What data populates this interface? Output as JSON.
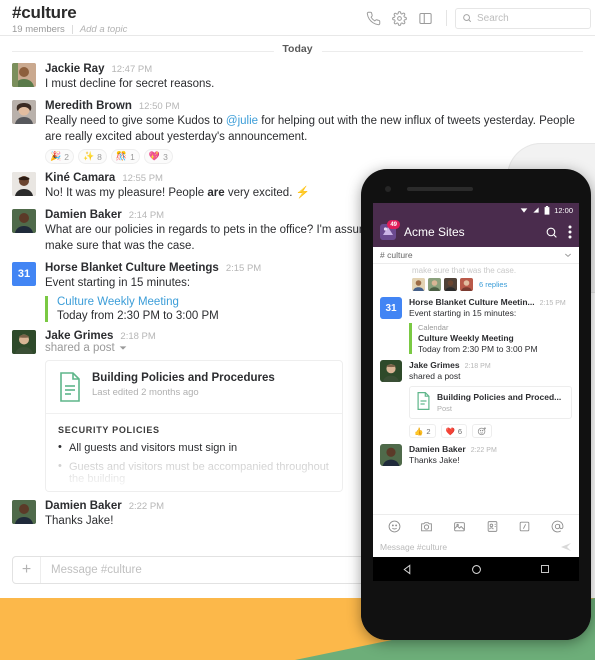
{
  "desktop": {
    "channel": {
      "name": "#culture",
      "members": "19 members",
      "topic": "Add a topic"
    },
    "header_icons": [
      "phone-icon",
      "gear-icon",
      "sidebar-icon"
    ],
    "search": {
      "placeholder": "Search",
      "icon": "search-icon"
    },
    "day_divider": "Today",
    "messages": [
      {
        "author": "Jackie Ray",
        "time": "12:47 PM",
        "text": "I must decline for secret reasons."
      },
      {
        "author": "Meredith Brown",
        "time": "12:50 PM",
        "text_pre": "Really need to give some Kudos to ",
        "mention": "@julie",
        "text_post": " for helping out with the new influx of tweets yesterday. People are really excited about yesterday's announcement.",
        "reactions": [
          {
            "emoji": "🎉",
            "count": "2"
          },
          {
            "emoji": "✨",
            "count": "8"
          },
          {
            "emoji": "🎊",
            "count": "1"
          },
          {
            "emoji": "💖",
            "count": "3"
          }
        ]
      },
      {
        "author": "Kiné Camara",
        "time": "12:55 PM",
        "text_pre": "No! It was my pleasure! People ",
        "bold": "are",
        "text_post": " very excited. ⚡"
      },
      {
        "author": "Damien Baker",
        "time": "2:14 PM",
        "text": "What are our policies in regards to pets in the office? I'm assuming we can bring them in but I want to make sure that was the case."
      },
      {
        "author": "Horse Blanket Culture Meetings",
        "time": "2:15 PM",
        "avatar": "calendar-icon",
        "avatar_label": "31",
        "text": "Event starting in 15 minutes:",
        "attachment": {
          "title": "Culture Weekly Meeting",
          "when": "Today from 2:30 PM to 3:00 PM"
        }
      },
      {
        "author": "Jake Grimes",
        "time": "2:18 PM",
        "shared": "shared a post",
        "post": {
          "title": "Building Policies and Procedures",
          "subtitle": "Last edited 2 months ago",
          "section": "SECURITY POLICIES",
          "bullets": [
            "All guests and visitors must sign in",
            "Guests and visitors must be accompanied throughout the building"
          ]
        }
      },
      {
        "author": "Damien Baker",
        "time": "2:22 PM",
        "text": "Thanks Jake!"
      }
    ],
    "composer": {
      "plus": "+",
      "placeholder": "Message #culture"
    }
  },
  "phone": {
    "statusbar": {
      "time": "12:00",
      "icons": [
        "wifi-icon",
        "signal-icon",
        "battery-icon"
      ]
    },
    "appbar": {
      "title": "Acme Sites",
      "badge": "49",
      "search_icon": "search-icon",
      "overflow_icon": "more-vertical-icon"
    },
    "channel_bar": {
      "name": "# culture",
      "chevron": "chevron-down-icon"
    },
    "cut_text": "make sure that was the case.",
    "thread": {
      "replies": "6 replies"
    },
    "messages": [
      {
        "author": "Horse Blanket Culture Meetin...",
        "time": "2:15 PM",
        "avatar": "calendar-icon",
        "avatar_label": "31",
        "text": "Event starting in 15 minutes:",
        "attachment": {
          "kicker": "Calendar",
          "title": "Culture Weekly Meeting",
          "when": "Today from 2:30 PM to 3:00 PM"
        }
      },
      {
        "author": "Jake Grimes",
        "time": "2:18 PM",
        "shared": "shared a post",
        "post": {
          "title": "Building Policies and Proced...",
          "subtitle": "Post"
        },
        "reactions": [
          {
            "emoji": "👍",
            "count": "2"
          },
          {
            "emoji": "❤️",
            "count": "6"
          },
          {
            "emoji": "add-reaction-icon",
            "count": ""
          }
        ]
      },
      {
        "author": "Damien Baker",
        "time": "2:22 PM",
        "text": "Thanks Jake!"
      }
    ],
    "toolbar_icons": [
      "emoji-icon",
      "camera-icon",
      "photo-icon",
      "contact-icon",
      "slash-command-icon",
      "mention-icon"
    ],
    "input": {
      "placeholder": "Message #culture",
      "send_icon": "send-icon"
    },
    "nav": [
      "back-icon",
      "home-icon",
      "recents-icon"
    ]
  },
  "decor": {
    "orange": "#fcb84a",
    "green": "#6dae79",
    "slack_purple": "#4a2c4d",
    "accent_blue": "#3b9dd8",
    "calendar_blue": "#4285f4",
    "attachment_green": "#7ac943"
  }
}
